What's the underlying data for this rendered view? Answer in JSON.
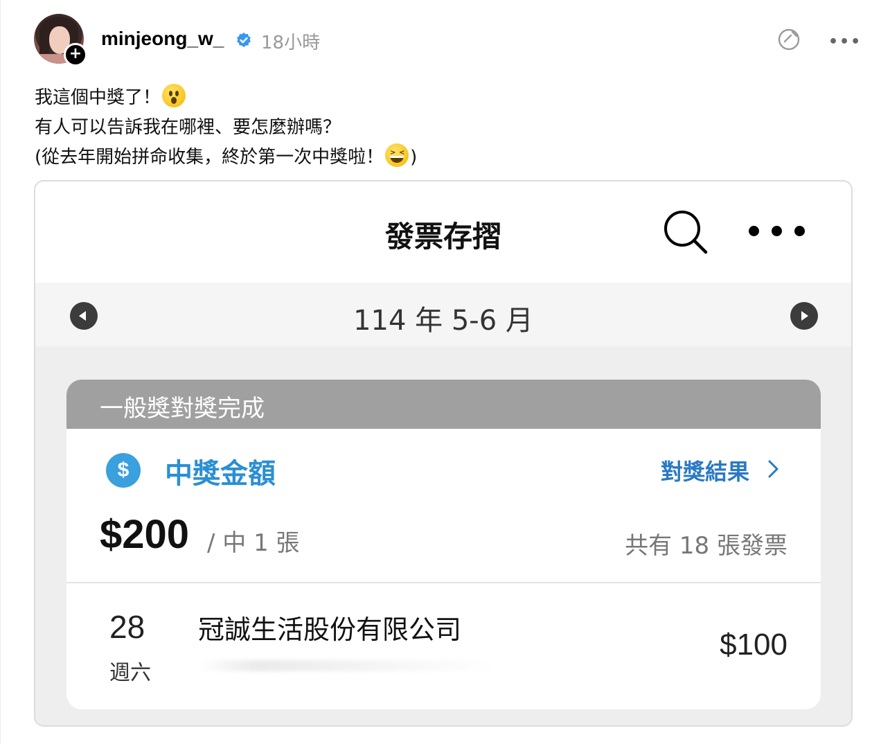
{
  "post": {
    "username": "minjeong_w_",
    "time": "18小時",
    "lines": [
      "我這個中獎了！",
      "有人可以告訴我在哪裡、要怎麼辦嗎？",
      "(從去年開始拼命收集，終於第一次中獎啦！",
      ")"
    ],
    "follow_glyph": "+"
  },
  "icons": {
    "avatar": "profile-photo",
    "verified": "verified-badge-icon",
    "repost": "repost-icon",
    "more": "more-dots-icon"
  },
  "colors": {
    "verified_blue": "#3897f0",
    "prize_blue": "#2b8fd3",
    "card_header_gray": "#a0a0a0"
  },
  "app": {
    "title": "發票存摺",
    "month": "114 年 5-6 月",
    "card_header": "一般獎對獎完成",
    "dollar_glyph": "$",
    "prize_label": "中獎金額",
    "result_link": "對獎結果",
    "amount": "$200",
    "amount_sub": "/ 中 1 張",
    "total_count": "共有 18 張發票",
    "invoice": {
      "day": "28",
      "weekday": "週六",
      "store": "冠誠生活股份有限公司",
      "amount": "$100"
    }
  }
}
